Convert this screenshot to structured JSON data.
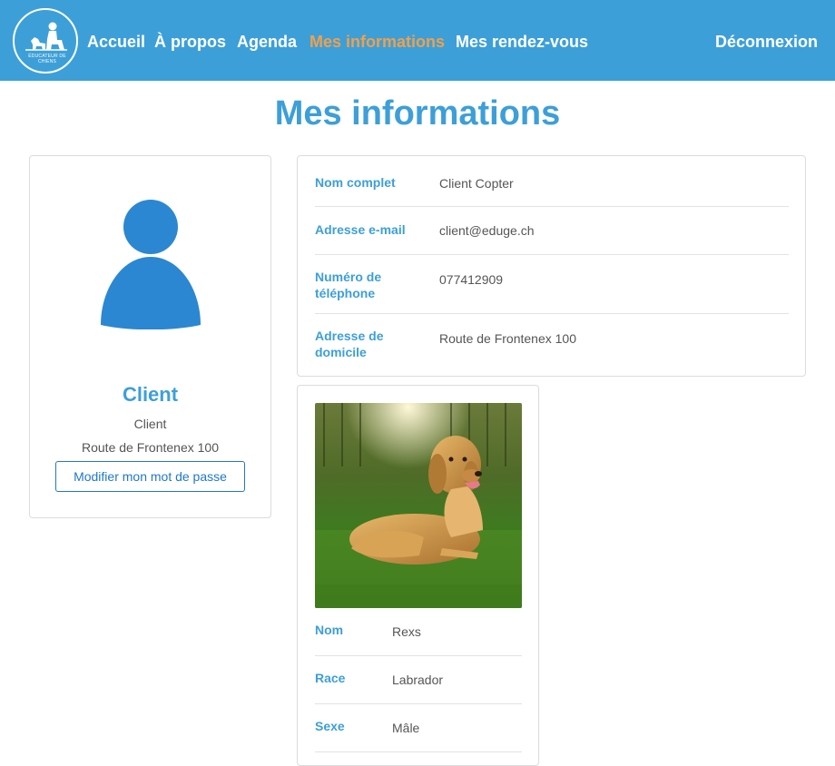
{
  "nav": {
    "logo_text": "ÉDUCATEUR DE CHIENS",
    "items": [
      {
        "label": "Accueil"
      },
      {
        "label": "À propos"
      },
      {
        "label": "Agenda"
      },
      {
        "label": "Mes informations"
      },
      {
        "label": "Mes rendez-vous"
      }
    ],
    "logout_label": "Déconnexion",
    "active_color": "#f0a04b",
    "background_color": "#3d9fd8"
  },
  "page": {
    "title": "Mes informations"
  },
  "profile": {
    "avatar_icon": "user-icon",
    "name": "Client",
    "role": "Client",
    "address": "Route de Frontenex 100",
    "change_password_label": "Modifier mon mot de passe"
  },
  "info": {
    "rows": [
      {
        "label": "Nom complet",
        "value": "Client Copter"
      },
      {
        "label": "Adresse e-mail",
        "value": "client@eduge.ch"
      },
      {
        "label": "Numéro de téléphone",
        "value": "077412909"
      },
      {
        "label": "Adresse de domicile",
        "value": "Route de Frontenex 100"
      }
    ]
  },
  "dog": {
    "rows": [
      {
        "label": "Nom",
        "value": "Rexs"
      },
      {
        "label": "Race",
        "value": "Labrador"
      },
      {
        "label": "Sexe",
        "value": "Mâle"
      }
    ]
  }
}
